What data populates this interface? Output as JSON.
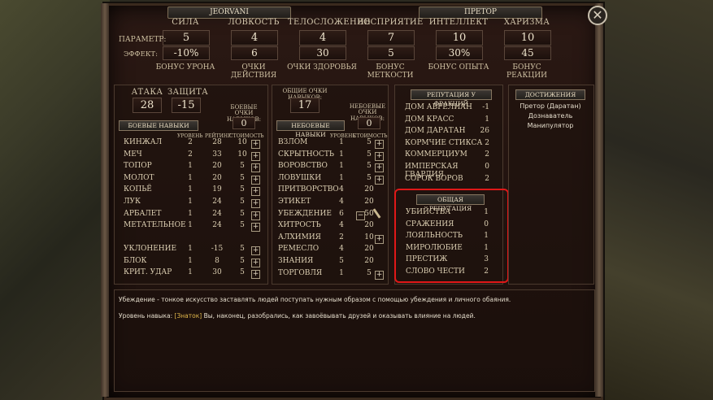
{
  "header": {
    "name": "JEORVANI",
    "rank": "ПРЕТОР",
    "close_glyph": "✕"
  },
  "attributes": {
    "param_label": "ПАРАМЕТР:",
    "effect_label": "ЭФФЕКТ:",
    "items": [
      {
        "name": "СИЛА",
        "value": "5",
        "effect": "-10%",
        "bonus": "БОНУС УРОНА"
      },
      {
        "name": "ЛОВКОСТЬ",
        "value": "4",
        "effect": "6",
        "bonus": "ОЧКИ ДЕЙСТВИЯ"
      },
      {
        "name": "ТЕЛОСЛОЖЕНИЕ",
        "value": "4",
        "effect": "30",
        "bonus": "ОЧКИ ЗДОРОВЬЯ"
      },
      {
        "name": "ВОСПРИЯТИЕ",
        "value": "7",
        "effect": "5",
        "bonus": "БОНУС МЕТКОСТИ"
      },
      {
        "name": "ИНТЕЛЛЕКТ",
        "value": "10",
        "effect": "30%",
        "bonus": "БОНУС ОПЫТА"
      },
      {
        "name": "ХАРИЗМА",
        "value": "10",
        "effect": "45",
        "bonus": "БОНУС РЕАКЦИИ"
      }
    ]
  },
  "combat": {
    "attack_label": "АТАКА",
    "attack_value": "28",
    "defense_label": "ЗАЩИТА",
    "defense_value": "-15",
    "points_label_1": "БОЕВЫЕ",
    "points_label_2": "ОЧКИ НАВЫКОВ:",
    "points_value": "0",
    "title": "БОЕВЫЕ НАВЫКИ",
    "col_level": "УРОВЕНЬ",
    "col_rating": "РЕЙТИНГ",
    "col_cost": "СТОИМОСТЬ",
    "skills": [
      {
        "name": "КИНЖАЛ",
        "level": "2",
        "rating": "28",
        "cost": "10"
      },
      {
        "name": "МЕЧ",
        "level": "2",
        "rating": "33",
        "cost": "10"
      },
      {
        "name": "ТОПОР",
        "level": "1",
        "rating": "20",
        "cost": "5"
      },
      {
        "name": "МОЛОТ",
        "level": "1",
        "rating": "20",
        "cost": "5"
      },
      {
        "name": "КОПЬЁ",
        "level": "1",
        "rating": "19",
        "cost": "5"
      },
      {
        "name": "ЛУК",
        "level": "1",
        "rating": "24",
        "cost": "5"
      },
      {
        "name": "АРБАЛЕТ",
        "level": "1",
        "rating": "24",
        "cost": "5"
      },
      {
        "name": "МЕТАТЕЛЬНОЕ",
        "level": "1",
        "rating": "24",
        "cost": "5"
      }
    ],
    "extra": [
      {
        "name": "УКЛОНЕНИЕ",
        "level": "1",
        "rating": "-15",
        "cost": "5"
      },
      {
        "name": "БЛОК",
        "level": "1",
        "rating": "8",
        "cost": "5"
      },
      {
        "name": "КРИТ. УДАР",
        "level": "1",
        "rating": "30",
        "cost": "5"
      }
    ]
  },
  "general": {
    "points_label": "ОБЩИЕ ОЧКИ НАВЫКОВ:",
    "points_value": "17",
    "noncombat_label_1": "НЕБОЕВЫЕ",
    "noncombat_label_2": "ОЧКИ НАВЫКОВ:",
    "noncombat_value": "0",
    "title": "НЕБОЕВЫЕ НАВЫКИ",
    "col_level": "УРОВЕНЬ",
    "col_cost": "СТОИМОСТЬ",
    "skills": [
      {
        "name": "ВЗЛОМ",
        "level": "1",
        "cost": "5",
        "plus": true
      },
      {
        "name": "СКРЫТНОСТЬ",
        "level": "1",
        "cost": "5",
        "plus": true
      },
      {
        "name": "ВОРОВСТВО",
        "level": "1",
        "cost": "5",
        "plus": true
      },
      {
        "name": "ЛОВУШКИ",
        "level": "1",
        "cost": "5",
        "plus": true
      },
      {
        "name": "ПРИТВОРСТВО",
        "level": "4",
        "cost": "20",
        "plus": false
      },
      {
        "name": "ЭТИКЕТ",
        "level": "4",
        "cost": "20",
        "plus": false
      },
      {
        "name": "УБЕЖДЕНИЕ",
        "level": "6",
        "cost": "50",
        "plus": false,
        "minus": true
      },
      {
        "name": "ХИТРОСТЬ",
        "level": "4",
        "cost": "20",
        "plus": false
      },
      {
        "name": "АЛХИМИЯ",
        "level": "2",
        "cost": "10",
        "plus": true
      },
      {
        "name": "РЕМЕСЛО",
        "level": "4",
        "cost": "20",
        "plus": false
      },
      {
        "name": "ЗНАНИЯ",
        "level": "5",
        "cost": "20",
        "plus": false
      },
      {
        "name": "ТОРГОВЛЯ",
        "level": "1",
        "cost": "5",
        "plus": true
      }
    ]
  },
  "reputation": {
    "title": "РЕПУТАЦИЯ У ФРАКЦИЙ",
    "factions": [
      {
        "name": "ДОМ АВРЕЛИАН",
        "value": "-1"
      },
      {
        "name": "ДОМ КРАСС",
        "value": "1"
      },
      {
        "name": "ДОМ ДАРАТАН",
        "value": "26"
      },
      {
        "name": "КОРМЧИЕ СТИКСА",
        "value": "2"
      },
      {
        "name": "КОММЕРЦИУМ",
        "value": "2"
      },
      {
        "name": "ИМПЕРСКАЯ ГВАРДИЯ",
        "value": "0"
      },
      {
        "name": "СОРОК ВОРОВ",
        "value": "2"
      }
    ],
    "general_title": "ОБЩАЯ РЕПУТАЦИЯ",
    "general": [
      {
        "name": "УБИЙСТВА",
        "value": "1"
      },
      {
        "name": "СРАЖЕНИЯ",
        "value": "0"
      },
      {
        "name": "ЛОЯЛЬНОСТЬ",
        "value": "1"
      },
      {
        "name": "МИРОЛЮБИЕ",
        "value": "1"
      },
      {
        "name": "ПРЕСТИЖ",
        "value": "3"
      },
      {
        "name": "СЛОВО ЧЕСТИ",
        "value": "2"
      }
    ]
  },
  "achievements": {
    "title": "ДОСТИЖЕНИЯ",
    "items": [
      "Претор (Даратан)",
      "Дознаватель",
      "Манипулятор"
    ]
  },
  "description": {
    "line1": "Убеждение - тонкое искусство заставлять людей поступать нужным образом с помощью убеждения и личного обаяния.",
    "line2_prefix": "Уровень навыка: ",
    "line2_rank": "[Знаток]",
    "line2_rest": " Вы, наконец, разобрались, как завоёвывать друзей и оказывать влияние на людей."
  },
  "colors": {
    "highlight": "#e01818",
    "rank_gold": "#e0b64a"
  }
}
